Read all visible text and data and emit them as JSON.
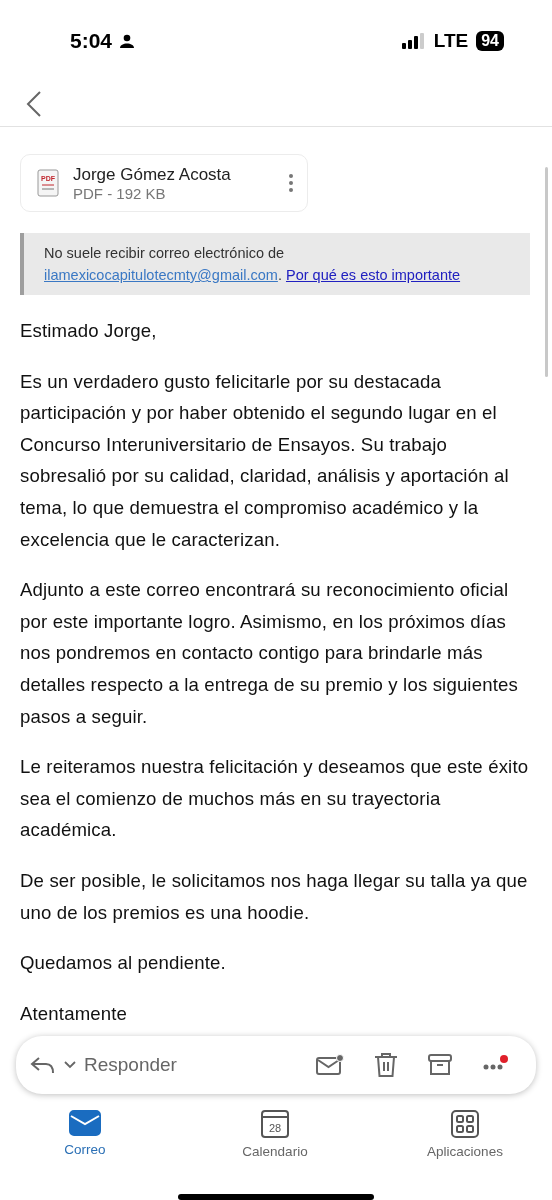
{
  "status_bar": {
    "time": "5:04",
    "network": "LTE",
    "battery": "94"
  },
  "attachment": {
    "name": "Jorge Gómez Acosta",
    "details": "PDF - 192 KB",
    "icon_label": "PDF"
  },
  "notice": {
    "text": "No suele recibir correo electrónico de",
    "email": "ilamexicocapitulotecmty@gmail.com",
    "separator": ".",
    "link": "Por qué es esto importante"
  },
  "body": [
    "Estimado Jorge,",
    "Es un verdadero gusto felicitarle por su destacada participación y por haber obtenido el segundo lugar en el Concurso Interuniversitario de Ensayos. Su trabajo sobresalió por su calidad, claridad, análisis y aportación al tema, lo que demuestra el compromiso académico y la excelencia que le caracterizan.",
    "Adjunto a este correo encontrará su reconocimiento oficial por este importante logro. Asimismo, en los próximos días nos pondremos en contacto contigo para brindarle más detalles respecto a la entrega de su premio y los siguientes pasos a seguir.",
    "Le reiteramos nuestra felicitación y deseamos que este éxito sea el comienzo de muchos más en su trayectoria académica.",
    "De ser posible, le solicitamos nos haga llegar su talla ya que uno de los premios es una hoodie.",
    "Quedamos al pendiente.",
    "Atentamente"
  ],
  "toolbar": {
    "reply": "Responder"
  },
  "tabs": [
    {
      "label": "Correo",
      "kind": "mail",
      "selected": true
    },
    {
      "label": "Calendario",
      "kind": "calendar",
      "selected": false,
      "icon_text": "28"
    },
    {
      "label": "Aplicaciones",
      "kind": "apps",
      "selected": false
    }
  ]
}
